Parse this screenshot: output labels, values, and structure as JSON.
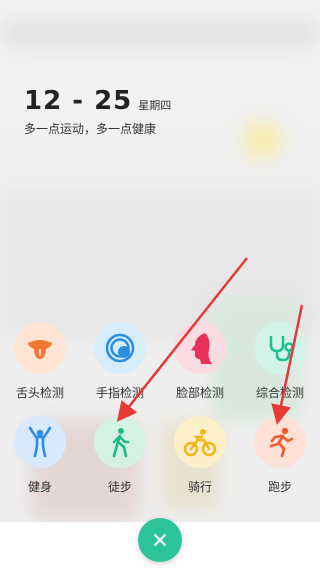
{
  "header": {
    "date": "12 - 25",
    "weekday": "星期四",
    "slogan": "多一点运动，多一点健康"
  },
  "actions": [
    {
      "label": "舌头检测",
      "icon": "tongue-icon",
      "bg": "#fde4d3",
      "color": "#f07a35"
    },
    {
      "label": "手指检测",
      "icon": "fingerprint-icon",
      "bg": "#d7ecfb",
      "color": "#2a8ee0"
    },
    {
      "label": "脸部检测",
      "icon": "face-profile-icon",
      "bg": "#fbdbe2",
      "color": "#e8315a"
    },
    {
      "label": "综合检测",
      "icon": "stethoscope-icon",
      "bg": "#d4f2e7",
      "color": "#1cbf92"
    },
    {
      "label": "健身",
      "icon": "fitness-icon",
      "bg": "#d8e9fb",
      "color": "#2e8de3"
    },
    {
      "label": "徒步",
      "icon": "walking-icon",
      "bg": "#d4f1e4",
      "color": "#1db888"
    },
    {
      "label": "骑行",
      "icon": "cycling-icon",
      "bg": "#fdf0c9",
      "color": "#f2b416"
    },
    {
      "label": "跑步",
      "icon": "running-icon",
      "bg": "#fde0d6",
      "color": "#f05a2c"
    }
  ],
  "close": {
    "icon": "close-icon",
    "color": "#2dc39a"
  },
  "annotations": {
    "arrow_color": "#e53935"
  }
}
